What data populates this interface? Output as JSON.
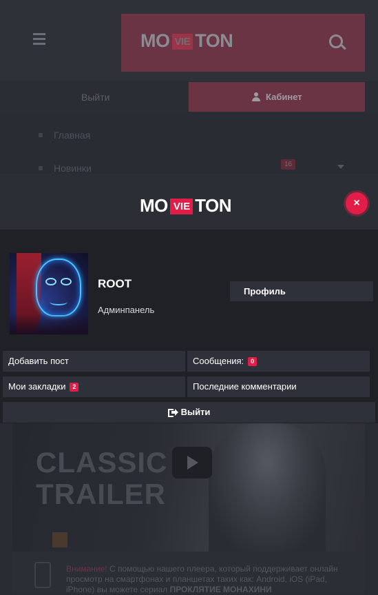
{
  "colors": {
    "accent": "#e11d48",
    "panel": "#2f313a",
    "modal_bg": "#1f2127",
    "header_bg": "#2c2e35"
  },
  "background": {
    "logo": {
      "left": "MO",
      "mid": "VIE",
      "right": "TON"
    },
    "exit_label": "Выйти",
    "cabinet_label": "Кабинет",
    "nav": [
      {
        "label": "Главная"
      },
      {
        "label": "Новинки",
        "count": "16"
      }
    ],
    "trailer_text": [
      "CLASSIC",
      "TRAILER"
    ],
    "info": {
      "highlight": "Внимание!",
      "text": " С помощью нашего плеера, который поддерживает онлайн просмотр на смартфонах и планшетах таких как: Android, iOS (iPad, iPhone) вы можете сериал ",
      "bold": "ПРОКЛЯТИЕ МОНАХИНИ"
    }
  },
  "modal": {
    "logo": {
      "left": "MO",
      "mid": "VIE",
      "right": "TON"
    },
    "close_icon": "×",
    "user": {
      "name": "ROOT",
      "admin_link": "Админпанель",
      "profile_button": "Профиль"
    },
    "buttons": {
      "add_post": "Добавить пост",
      "messages": {
        "label": "Сообщения:",
        "count": "0"
      },
      "bookmarks": {
        "label": "Мои закладки",
        "count": "2"
      },
      "last_comments": "Последние комментарии",
      "logout": "Выйти"
    }
  }
}
